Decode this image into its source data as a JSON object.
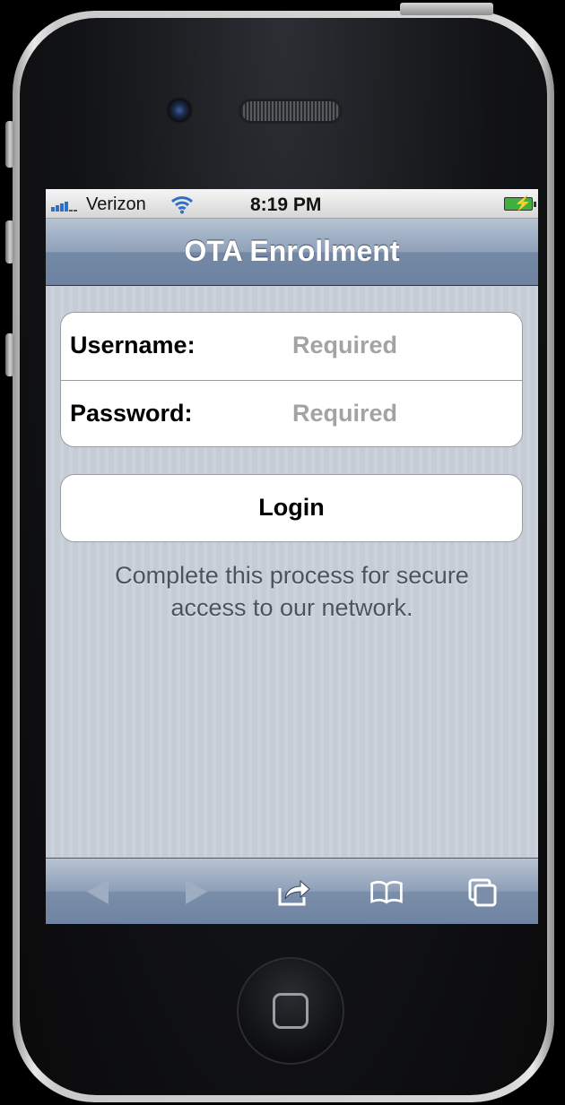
{
  "status_bar": {
    "carrier": "Verizon",
    "time": "8:19 PM",
    "signal_icon": "signal-bars-icon",
    "wifi_icon": "wifi-icon",
    "battery_icon": "battery-charging-icon"
  },
  "nav": {
    "title": "OTA Enrollment"
  },
  "form": {
    "username_label": "Username:",
    "username_placeholder": "Required",
    "password_label": "Password:",
    "password_placeholder": "Required"
  },
  "login_button": {
    "label": "Login"
  },
  "info_text": "Complete this process for secure access to our network.",
  "toolbar": {
    "items": [
      "back-arrow-icon",
      "forward-arrow-icon",
      "share-icon",
      "bookmarks-icon",
      "tabs-icon"
    ]
  },
  "colors": {
    "nav_bar": "#7a8ea9",
    "content_background": "#c5ccd6",
    "placeholder_text": "#a3a3a3",
    "info_text": "#4b5360"
  }
}
